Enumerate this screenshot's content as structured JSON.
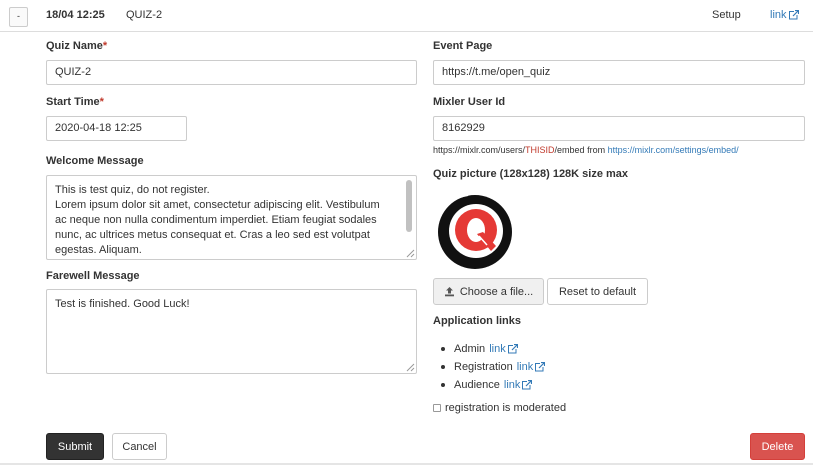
{
  "header": {
    "collapse_label": "-",
    "date": "18/04 12:25",
    "quiz_name": "QUIZ-2",
    "setup_label": "Setup",
    "link_label": "link"
  },
  "left": {
    "quiz_name_label": "Quiz Name",
    "quiz_name_value": "QUIZ-2",
    "start_time_label": "Start Time",
    "start_time_value": "2020-04-18 12:25",
    "required_mark": "*",
    "welcome_label": "Welcome Message",
    "welcome_lines": [
      "This is test quiz, do not register.",
      "Lorem ipsum dolor sit amet, consectetur adipiscing elit. Vestibulum",
      "ac neque non nulla condimentum imperdiet. Etiam feugiat sodales",
      "nunc, ac ultrices metus consequat et. Cras a leo sed est volutpat",
      "egestas. Aliquam."
    ],
    "farewell_label": "Farewell Message",
    "farewell_value": "Test is finished. Good Luck!"
  },
  "right": {
    "event_page_label": "Event Page",
    "event_page_value": "https://t.me/open_quiz",
    "mixler_label": "Mixler User Id",
    "mixler_value": "8162929",
    "mixlr_help": {
      "prefix": "https://mixlr.com/users/",
      "placeholder": "THISID",
      "middle": "/embed from ",
      "link": "https://mixlr.com/settings/embed/"
    },
    "picture_label": "Quiz picture (128x128) 128K size max",
    "choose_file_label": "Choose a file...",
    "reset_label": "Reset to default",
    "app_links_label": "Application links",
    "app_links": [
      {
        "name": "Admin",
        "link_label": "link"
      },
      {
        "name": "Registration",
        "link_label": "link"
      },
      {
        "name": "Audience",
        "link_label": "link"
      }
    ],
    "moderated_label": "registration is moderated",
    "moderated_checked": false
  },
  "footer": {
    "submit_label": "Submit",
    "cancel_label": "Cancel",
    "delete_label": "Delete"
  },
  "colors": {
    "link": "#337ab7",
    "required": "#c0392b",
    "submit_bg": "#333333",
    "delete_bg": "#d9534f",
    "logo_red": "#e53935"
  },
  "icons": {
    "external_link": "external-link-icon",
    "upload": "upload-icon",
    "logo": "quiz-logo"
  }
}
